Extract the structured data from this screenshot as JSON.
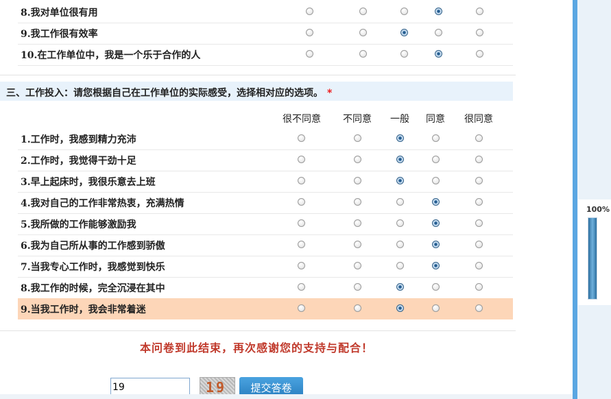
{
  "prev_section": {
    "rows": [
      {
        "label": "8.我对单位很有用",
        "selected": 3
      },
      {
        "label": "9.我工作很有效率",
        "selected": 2
      },
      {
        "label": "10.在工作单位中，我是一个乐于合作的人",
        "selected": 3
      }
    ]
  },
  "section3": {
    "title": "三、工作投入：请您根据自己在工作单位的实际感受，选择相对应的选项。",
    "required_mark": "*",
    "options": [
      "很不同意",
      "不同意",
      "一般",
      "同意",
      "很同意"
    ],
    "rows": [
      {
        "label": "1.工作时，我感到精力充沛",
        "selected": 2
      },
      {
        "label": "2.工作时，我觉得干劲十足",
        "selected": 2
      },
      {
        "label": "3.早上起床时，我很乐意去上班",
        "selected": 2
      },
      {
        "label": "4.我对自己的工作非常热衷，充满热情",
        "selected": 3
      },
      {
        "label": "5.我所做的工作能够激励我",
        "selected": 3
      },
      {
        "label": "6.我为自己所从事的工作感到骄傲",
        "selected": 3
      },
      {
        "label": "7.当我专心工作时，我感觉到快乐",
        "selected": 3
      },
      {
        "label": "8.我工作的时候，完全沉浸在其中",
        "selected": 2
      },
      {
        "label": "9.当我工作时，我会非常着迷",
        "selected": 2,
        "highlighted": true
      }
    ]
  },
  "end_message": "本问卷到此结束，再次感谢您的支持与配合！",
  "captcha": {
    "value": "19",
    "image_text": "19"
  },
  "submit_label": "提交答卷",
  "progress": {
    "label": "100%",
    "fraction": 1.0
  },
  "colors": {
    "highlight_row": "#fdd6b8",
    "section_header_bg": "#e8f2fb",
    "end_message": "#c0392b",
    "accent": "#5aa6e2"
  }
}
